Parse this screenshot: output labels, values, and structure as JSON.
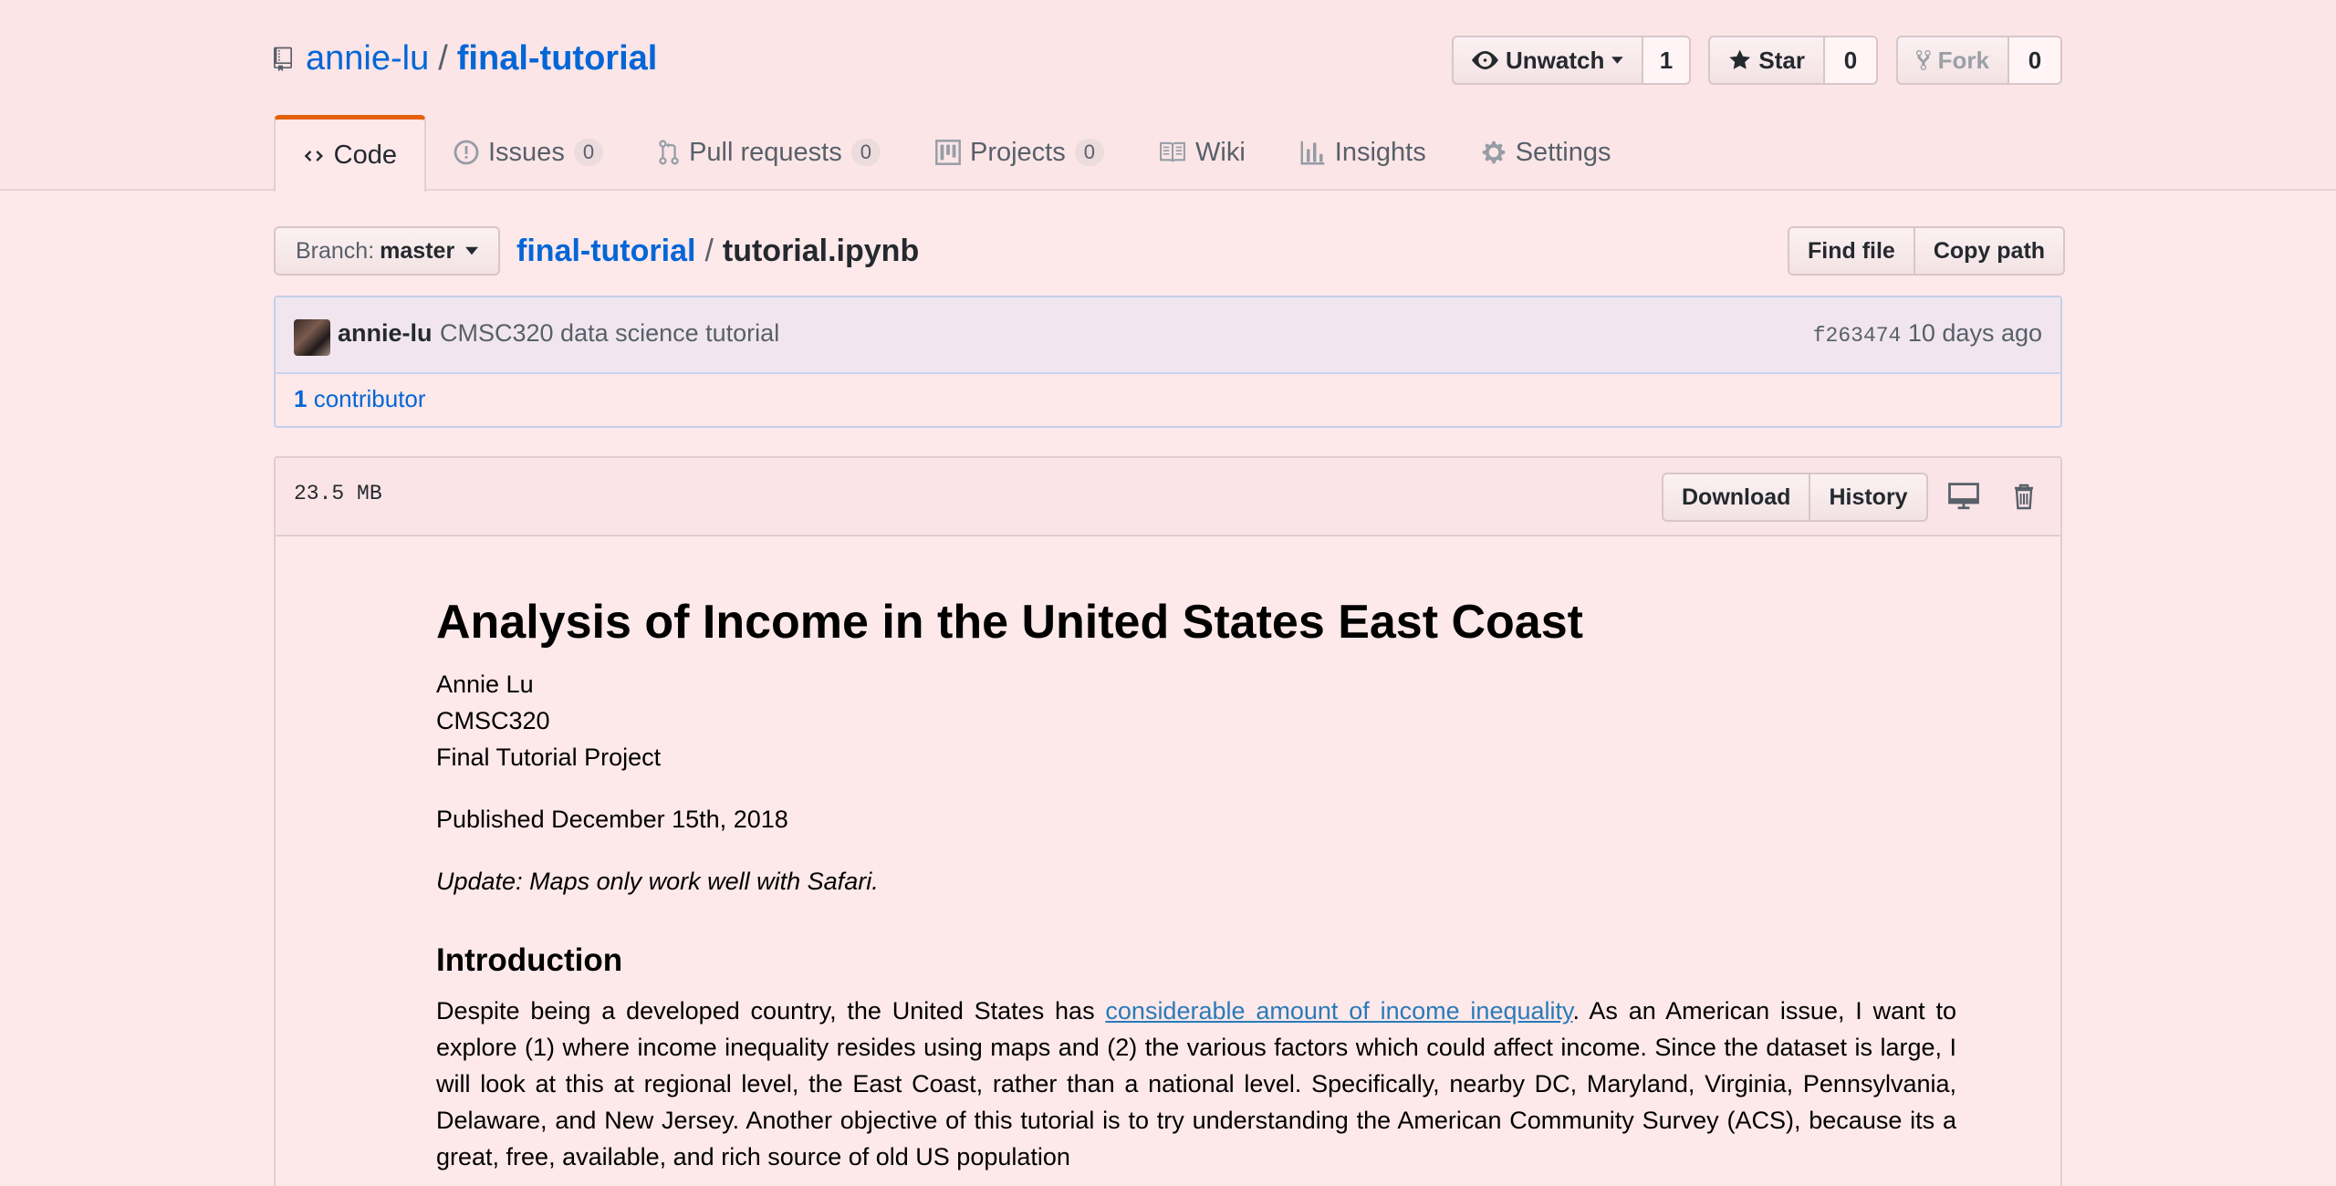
{
  "repo": {
    "owner": "annie-lu",
    "separator": "/",
    "name": "final-tutorial"
  },
  "actions": {
    "watch": {
      "label": "Unwatch",
      "count": "1"
    },
    "star": {
      "label": "Star",
      "count": "0"
    },
    "fork": {
      "label": "Fork",
      "count": "0"
    }
  },
  "tabs": [
    {
      "label": "Code",
      "icon": "code-icon"
    },
    {
      "label": "Issues",
      "count": "0",
      "icon": "issue-icon"
    },
    {
      "label": "Pull requests",
      "count": "0",
      "icon": "pull-request-icon"
    },
    {
      "label": "Projects",
      "count": "0",
      "icon": "project-icon"
    },
    {
      "label": "Wiki",
      "icon": "book-icon"
    },
    {
      "label": "Insights",
      "icon": "graph-icon"
    },
    {
      "label": "Settings",
      "icon": "gear-icon"
    }
  ],
  "branch": {
    "prefix": "Branch:",
    "name": "master"
  },
  "breadcrumb": {
    "root": "final-tutorial",
    "separator": "/",
    "file": "tutorial.ipynb"
  },
  "file_tools": {
    "find": "Find file",
    "copy": "Copy path"
  },
  "commit": {
    "author": "annie-lu",
    "message": "CMSC320 data science tutorial",
    "sha": "f263474",
    "age": "10 days ago",
    "contributors_count": "1",
    "contributors_label": "contributor"
  },
  "file": {
    "size": "23.5 MB",
    "download": "Download",
    "history": "History"
  },
  "notebook": {
    "title": "Analysis of Income in the United States East Coast",
    "author_lines": [
      "Annie Lu",
      "CMSC320",
      "Final Tutorial Project"
    ],
    "published": "Published December 15th, 2018",
    "update_note": "Update: Maps only work well with Safari.",
    "intro_heading": "Introduction",
    "intro_before_link": "Despite being a developed country, the United States has ",
    "intro_link": "considerable amount of income inequality",
    "intro_after_link": ". As an American issue, I want to explore (1) where income inequality resides using maps and (2) the various factors which could affect income. Since the dataset is large, I will look at this at regional level, the East Coast, rather than a national level. Specifically, nearby DC, Maryland, Virginia, Pennsylvania, Delaware, and New Jersey. Another objective of this tutorial is to try understanding the American Community Survey (ACS), because its a great, free, available, and rich source of old US population"
  },
  "colors": {
    "background": "#fde8ea",
    "link": "#0366d6",
    "selected_tab_accent": "#e36209"
  }
}
